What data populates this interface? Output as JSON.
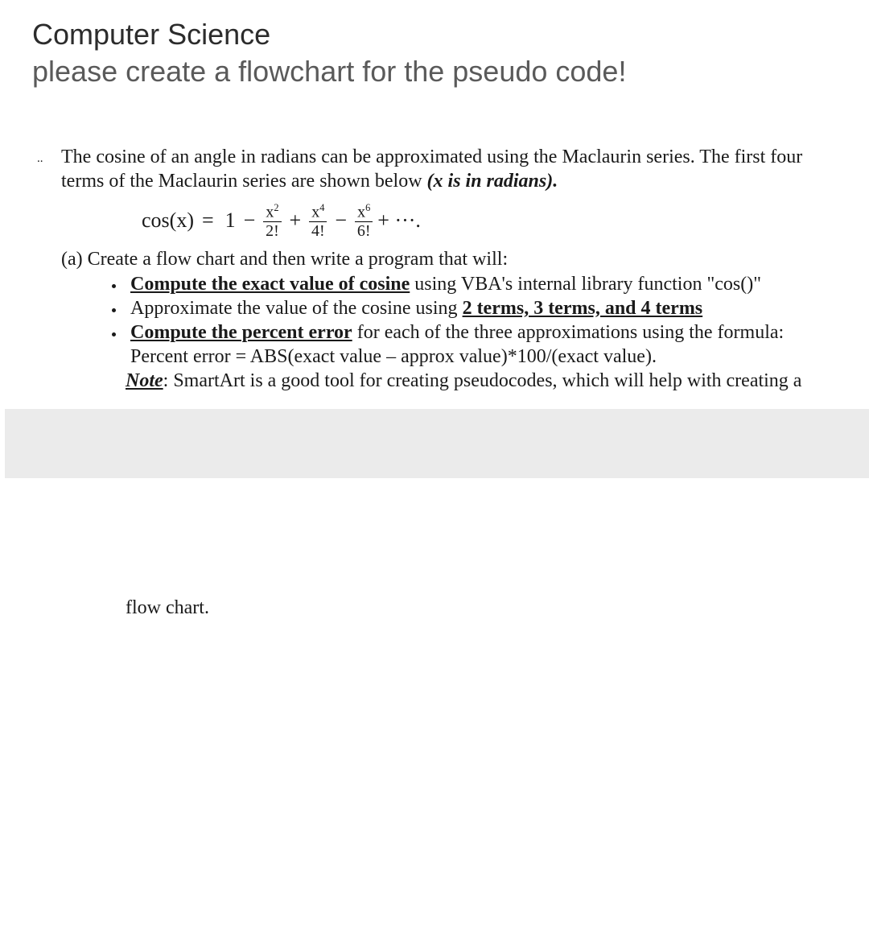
{
  "header": {
    "subject": "Computer Science",
    "request": "please create a flowchart for the pseudo code!"
  },
  "problem": {
    "lead_bullet": "..",
    "intro_part1": "The cosine of an angle in radians can be approximated using the Maclaurin series. The first four terms of the Maclaurin series are shown below ",
    "intro_emph": "(x is in radians).",
    "formula": {
      "lhs": "cos(x)",
      "eq": "=",
      "first": "1",
      "op1": "−",
      "f1_num_base": "x",
      "f1_num_pow": "2",
      "f1_den": "2!",
      "op2": "+",
      "f2_num_base": "x",
      "f2_num_pow": "4",
      "f2_den": "4!",
      "op3": "−",
      "f3_num_base": "x",
      "f3_num_pow": "6",
      "f3_den": "6!",
      "trail": "+ ···."
    },
    "part_a_lead": "(a) Create a flow chart and then write a program that will:",
    "bullets": {
      "b1_ul": "Compute the exact value of cosine",
      "b1_rest": " using VBA's internal library function \"cos()\"",
      "b2_lead": "Approximate the value of the cosine using ",
      "b2_ul": "2 terms, 3 terms, and 4 terms",
      "b3_ul": "Compute the percent error",
      "b3_rest": " for each of the three approximations using the formula:  Percent error = ABS(exact value – approx value)*100/(exact value)."
    },
    "note_label": "Note",
    "note_text": ": SmartArt is a good tool for creating pseudocodes, which will help with creating a",
    "continuation": "flow chart."
  }
}
